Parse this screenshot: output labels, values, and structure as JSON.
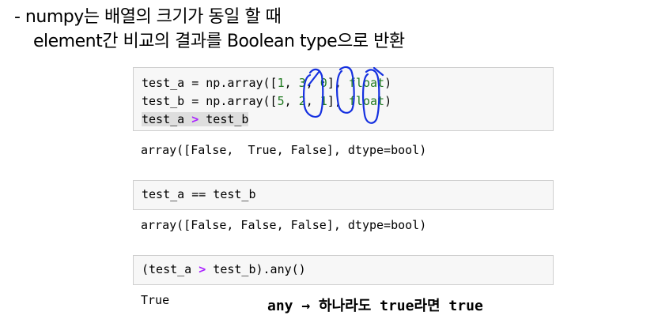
{
  "heading": {
    "line1": "- numpy는 배열의 크기가 동일 할 때",
    "line2": "element간 비교의 결과를 Boolean type으로 반환"
  },
  "cell1": {
    "line1": {
      "var": "test_a",
      "eq": " = np.array([",
      "n1": "1",
      "c1": ", ",
      "n2": "3",
      "c2": ", ",
      "n3": "0",
      "c3": "], ",
      "kw": "float",
      "end": ")"
    },
    "line2": {
      "var": "test_b",
      "eq": " = np.array([",
      "n1": "5",
      "c1": ", ",
      "n2": "2",
      "c2": ", ",
      "n3": "1",
      "c3": "], ",
      "kw": "float",
      "end": ")"
    },
    "line3": {
      "left": "test_a ",
      "op": ">",
      "right": " test_b"
    }
  },
  "output1": "array([False,  True, False], dtype=bool)",
  "cell2": {
    "code": "test_a == test_b"
  },
  "output2": "array([False, False, False], dtype=bool)",
  "cell3": {
    "left": "(test_a ",
    "op": ">",
    "right": " test_b).any()"
  },
  "output3": "True",
  "note": {
    "text_any": "any",
    "arrow": "→",
    "text_rest": "하나라도 true라면 true"
  },
  "colors": {
    "annotation_ink": "#1530e0",
    "keyword": "#1f7a1f",
    "operator": "#aa22ff"
  }
}
